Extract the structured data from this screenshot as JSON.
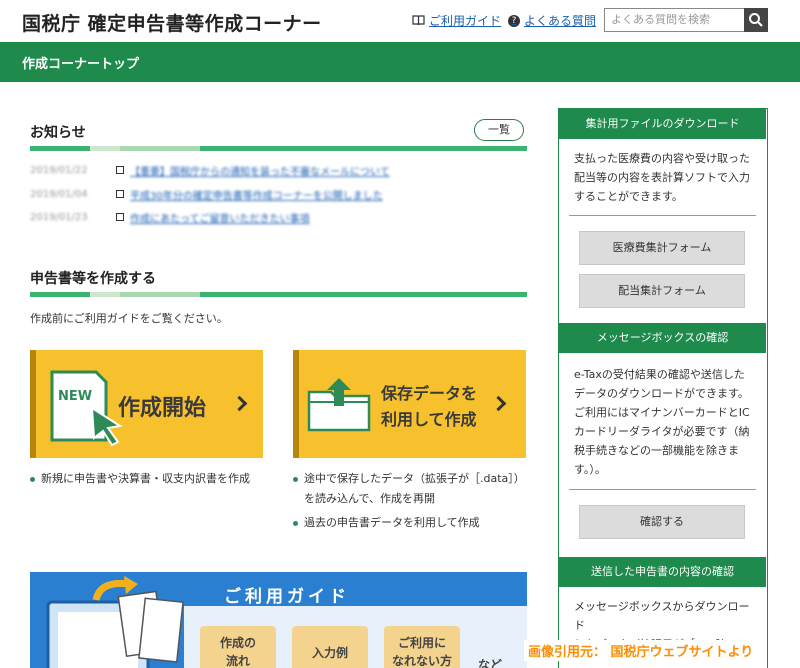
{
  "header": {
    "site_title": "国税庁 確定申告書等作成コーナー",
    "guide_link": "ご利用ガイド",
    "faq_link": "よくある質問",
    "search_placeholder": "よくある質問を検索"
  },
  "greenbar": {
    "title": "作成コーナートップ"
  },
  "news": {
    "title": "お知らせ",
    "more_button": "一覧",
    "items": [
      {
        "date": "2019/01/22",
        "text": "【重要】国税庁からの通知を装った不審なメールについて"
      },
      {
        "date": "2019/01/04",
        "text": "平成30年分の確定申告書等作成コーナーを公開しました"
      },
      {
        "date": "2019/01/23",
        "text": "作成にあたってご留意いただきたい事項"
      }
    ]
  },
  "create": {
    "title": "申告書等を作成する",
    "intro": "作成前にご利用ガイドをご覧ください。",
    "start_tile": {
      "badge": "NEW",
      "label": "作成開始"
    },
    "saved_tile": {
      "line1": "保存データを",
      "line2": "利用して作成"
    },
    "start_bullets": [
      "新規に申告書や決算書・収支内訳書を作成"
    ],
    "saved_bullets": [
      "途中で保存したデータ（拡張子が［.data］）",
      "を読み込んで、作成を再開",
      "過去の申告書データを利用して作成"
    ]
  },
  "guide": {
    "title": "ご利用ガイド",
    "buttons": [
      {
        "line1": "作成の",
        "line2": "流れ"
      },
      {
        "line1": "入力例",
        "line2": ""
      },
      {
        "line1": "ご利用に",
        "line2": "なれない方"
      }
    ],
    "more": "など"
  },
  "sidebar": {
    "download": {
      "title": "集計用ファイルのダウンロード",
      "desc": [
        "支払った医療費の内容や受け取った",
        "配当等の内容を表計算ソフトで入力",
        "することができます。"
      ],
      "button1": "医療費集計フォーム",
      "button2": "配当集計フォーム"
    },
    "messagebox": {
      "title": "メッセージボックスの確認",
      "desc": [
        "e-Taxの受付結果の確認や送信した",
        "データのダウンロードができます。",
        "ご利用にはマイナンバーカードとIC",
        "カードリーダライタが必要です（納",
        "税手続きなどの一部機能を除きま",
        "す。）。"
      ],
      "button": "確認する"
    },
    "sent": {
      "title": "送信した申告書の内容の確認",
      "desc": [
        "メッセージボックスからダウンロード",
        "したデータ（拡張子が［.xtx］）"
      ]
    }
  },
  "watermark": "画像引用元： 国税庁ウェブサイトより",
  "colors": {
    "brand_green": "#1e8a4c",
    "tile_yellow": "#f7c12d",
    "link_blue": "#1a5fb4",
    "guide_blue": "#2a7fd1"
  }
}
